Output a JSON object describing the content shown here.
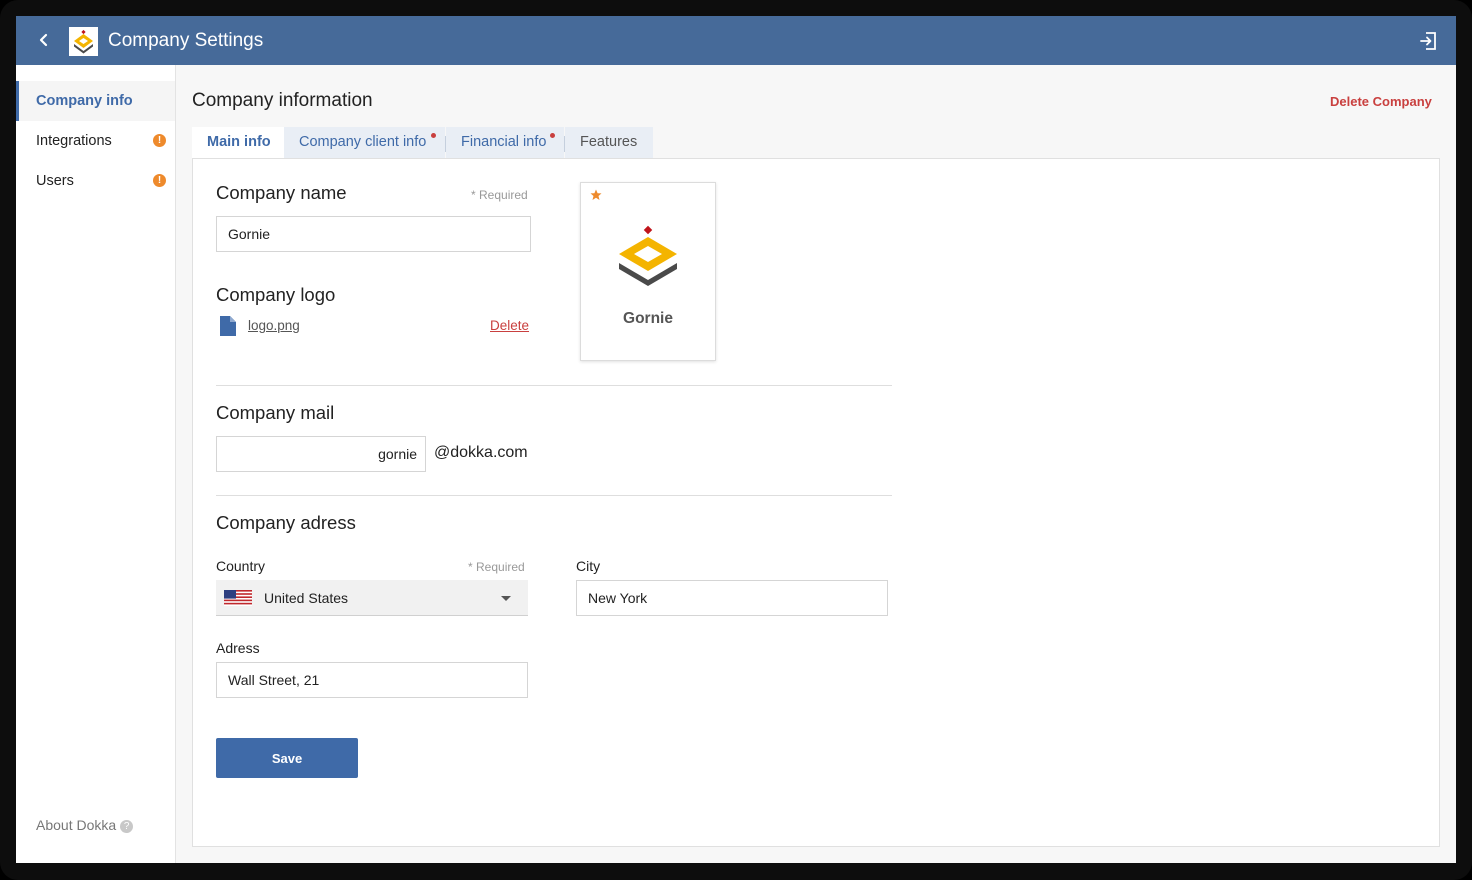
{
  "header": {
    "title": "Company Settings",
    "back_icon": "chevron-left-icon",
    "exit_icon": "sign-out-icon",
    "color": "#466a99"
  },
  "sidebar": {
    "items": [
      {
        "label": "Company info",
        "active": true,
        "warning": false
      },
      {
        "label": "Integrations",
        "active": false,
        "warning": true,
        "badge": "!"
      },
      {
        "label": "Users",
        "active": false,
        "warning": true,
        "badge": "!"
      }
    ],
    "about_label": "About Dokka",
    "help_glyph": "?"
  },
  "main": {
    "title": "Company information",
    "delete_company_label": "Delete Company",
    "tabs": [
      {
        "label": "Main info",
        "active": true,
        "dot": false
      },
      {
        "label": "Company client info",
        "active": false,
        "dot": true
      },
      {
        "label": "Financial info",
        "active": false,
        "dot": true
      },
      {
        "label": "Features",
        "active": false,
        "dot": false
      }
    ]
  },
  "form": {
    "company_name": {
      "title": "Company name",
      "required": "* Required",
      "value": "Gornie"
    },
    "company_logo": {
      "title": "Company logo",
      "file_name": "logo.png",
      "delete_label": "Delete"
    },
    "logo_preview": {
      "name": "Gornie"
    },
    "company_mail": {
      "title": "Company mail",
      "value": "gornie",
      "domain": "@dokka.com"
    },
    "company_address": {
      "title": "Company adress",
      "country_label": "Country",
      "country_required": "* Required",
      "country_value": "United States",
      "city_label": "City",
      "city_value": "New York",
      "address_label": "Adress",
      "address_value": "Wall Street, 21"
    },
    "save_label": "Save"
  },
  "colors": {
    "accent": "#3f6aa8",
    "danger": "#c9403f",
    "warning": "#ee8a2c"
  }
}
